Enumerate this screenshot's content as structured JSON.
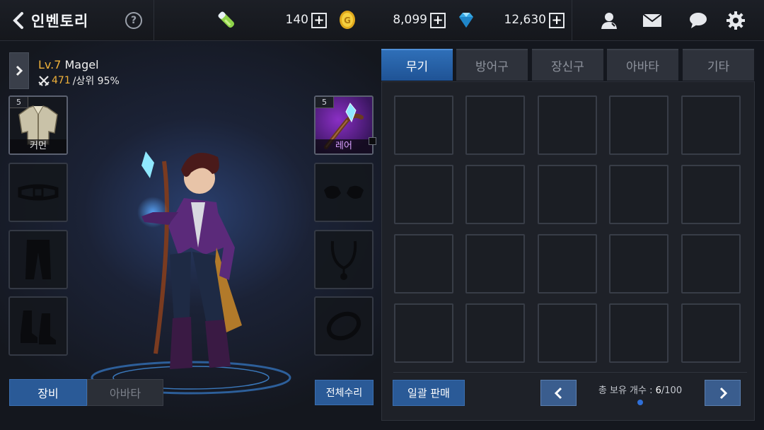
{
  "header": {
    "title": "인벤토리",
    "help_label": "?",
    "stamina": "140",
    "gold": "8,099",
    "gems": "12,630",
    "plus_label": "+"
  },
  "character": {
    "level": "Lv.7",
    "name": "Magel",
    "power": "471",
    "rank": "/상위 95%"
  },
  "equipment": {
    "left": [
      {
        "icon": "jacket-icon",
        "count": "5",
        "grade": "커먼"
      },
      {
        "icon": "belt-icon"
      },
      {
        "icon": "pants-icon"
      },
      {
        "icon": "boots-icon"
      }
    ],
    "right": [
      {
        "icon": "staff-icon",
        "count": "5",
        "grade": "레어"
      },
      {
        "icon": "gloves-icon"
      },
      {
        "icon": "necklace-icon"
      },
      {
        "icon": "ring-icon"
      }
    ]
  },
  "left_tabs": {
    "equip": "장비",
    "avatar": "아바타"
  },
  "repair_all": "전체수리",
  "inventory": {
    "tabs": [
      "무기",
      "방어구",
      "장신구",
      "아바타",
      "기타"
    ],
    "active_tab": 0,
    "sell_all": "일괄 판매",
    "count_label": "총 보유 개수 : ",
    "count_current": "6",
    "count_total": "/100"
  },
  "colors": {
    "accent": "#2a5a97",
    "level": "#f0b23a",
    "rare": "#d9a0ff"
  }
}
